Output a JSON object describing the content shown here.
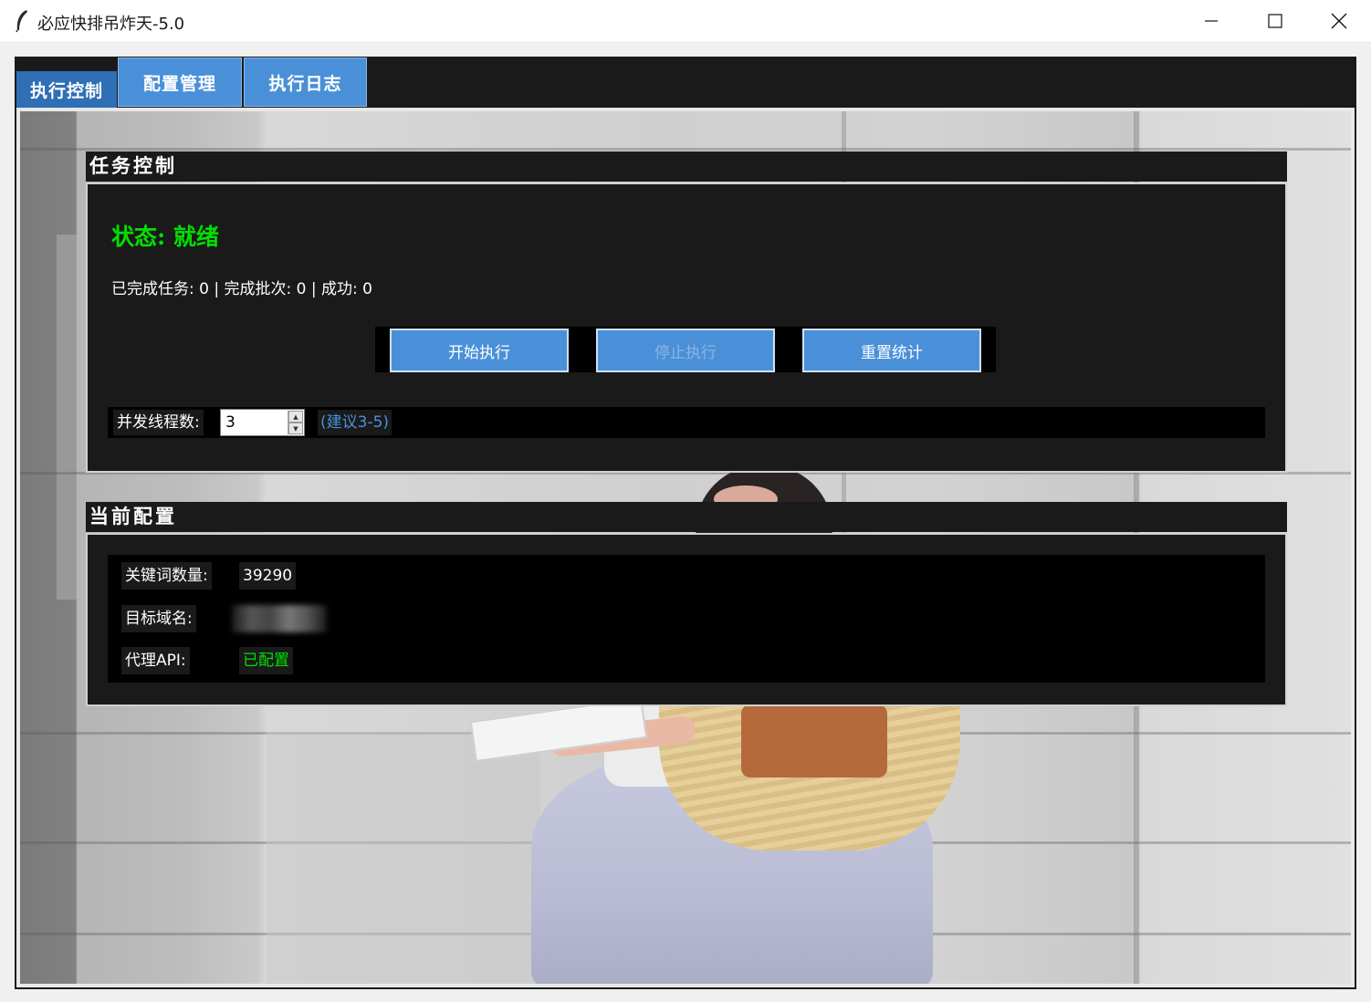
{
  "window": {
    "title": "必应快排吊炸天-5.0"
  },
  "tabs": [
    {
      "label": "执行控制",
      "active": true
    },
    {
      "label": "配置管理",
      "active": false
    },
    {
      "label": "执行日志",
      "active": false
    }
  ],
  "task_control": {
    "title": "任务控制",
    "status": "状态: 就绪",
    "stats": "已完成任务: 0 | 完成批次: 0 | 成功: 0",
    "buttons": {
      "start": "开始执行",
      "stop": "停止执行",
      "reset": "重置统计"
    },
    "threads": {
      "label": "并发线程数:",
      "value": "3",
      "hint": "(建议3-5)"
    }
  },
  "current_config": {
    "title": "当前配置",
    "rows": [
      {
        "key": "关键词数量:",
        "value": "39290"
      },
      {
        "key": "目标域名:",
        "value": ""
      },
      {
        "key": "代理API:",
        "value": "已配置"
      }
    ]
  },
  "colors": {
    "accent": "#4a90d9",
    "status_ok": "#00e000",
    "panel_bg": "#1a1a1a"
  },
  "icons": {
    "app": "feather-icon",
    "minimize": "minimize-icon",
    "maximize": "maximize-icon",
    "close": "close-icon"
  }
}
